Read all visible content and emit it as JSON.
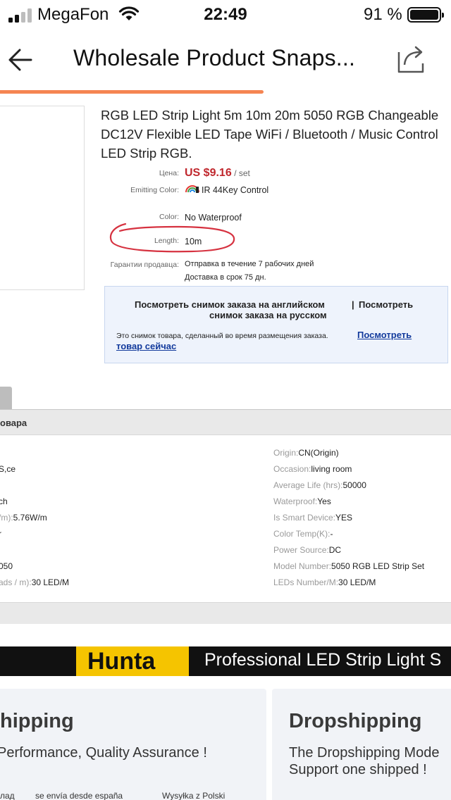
{
  "status_bar": {
    "carrier": "MegaFon",
    "time": "22:49",
    "battery": "91 %"
  },
  "nav": {
    "title": "Wholesale Product Snaps...",
    "back_icon": "back-arrow-icon",
    "share_icon": "share-icon",
    "load_progress": 0.585,
    "progress_color": "#f58552"
  },
  "product": {
    "title": "RGB LED Strip Light 5m 10m 20m 5050 RGB Changeable DC12V Flexible LED Tape WiFi / Bluetooth / Music Control LED Strip RGB.",
    "price_label": "Цена:",
    "price": "US $9.16",
    "price_unit": "/ set",
    "price_color": "#c0272d",
    "emitting_label": "Emitting Color:",
    "emitting_value": "IR 44Key Control",
    "color_label": "Color:",
    "color_value": "No Waterproof",
    "length_label": "Length:",
    "length_value": "10m",
    "guarantee_label": "Гарантии продавца:",
    "guarantee_line1": "Отправка в течение 7 рабочих дней",
    "guarantee_line2": "Доставка в срок 75 дн."
  },
  "snapshot": {
    "line1_part1": "Посмотреть снимок заказа на английском",
    "line1_part2": "Посмотреть",
    "line2": "снимок заказа на русском",
    "note": "Это снимок товара, сделанный во время размещения заказа.",
    "link_part1": "Посмотреть",
    "link_part2": "товар сейчас"
  },
  "specs": {
    "header": "овара",
    "left": [
      {
        "k": "",
        "v": ""
      },
      {
        "k": "",
        "v": "S,ce"
      },
      {
        "k": "",
        "v": ""
      },
      {
        "k": "",
        "v": "ch"
      },
      {
        "k": "/m):",
        "v": "5.76W/m"
      },
      {
        "k": "",
        "v": "r"
      },
      {
        "k": "",
        "v": ""
      },
      {
        "k": "",
        "v": "050"
      },
      {
        "k": "ads / m):",
        "v": "30 LED/M"
      }
    ],
    "right": [
      {
        "k": "Origin:",
        "v": "CN(Origin)"
      },
      {
        "k": "Occasion:",
        "v": "living room"
      },
      {
        "k": "Average Life (hrs):",
        "v": "50000"
      },
      {
        "k": "Waterproof:",
        "v": "Yes"
      },
      {
        "k": "Is Smart Device:",
        "v": "YES"
      },
      {
        "k": "Color Temp(K):",
        "v": "-"
      },
      {
        "k": "Power Source:",
        "v": "DC"
      },
      {
        "k": "Model Number:",
        "v": "5050 RGB LED Strip Set"
      },
      {
        "k": "LEDs Number/M:",
        "v": "30 LED/M"
      }
    ]
  },
  "banner": {
    "brand": "Hunta",
    "tagline": "Professional  LED Strip Light S",
    "brand_color": "#f5c400"
  },
  "cards": [
    {
      "title": "hipping",
      "line1": " Performance, Quality Assurance !",
      "line2": "",
      "foot1": "лад",
      "foot2": "se envía desde españa",
      "foot3": "Wysyłka z Polski"
    },
    {
      "title": "Dropshipping",
      "line1": "The Dropshipping Mode",
      "line2": "Support one shipped !",
      "foot1": "",
      "foot2": "",
      "foot3": ""
    }
  ]
}
